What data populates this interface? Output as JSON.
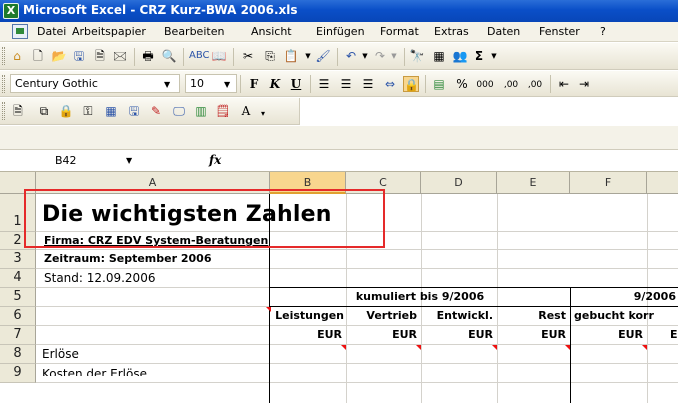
{
  "window": {
    "title": "Microsoft Excel - CRZ Kurz-BWA 2006.xls"
  },
  "menu": [
    "Datei",
    "Arbeitspapier",
    "Bearbeiten",
    "Ansicht",
    "Einfügen",
    "Format",
    "Extras",
    "Daten",
    "Fenster",
    "?"
  ],
  "format_toolbar": {
    "font": "Century Gothic",
    "size": "10",
    "bold": "F",
    "italic": "K",
    "underline": "U",
    "percent": "%",
    "thousands": "000",
    "inc_dec": ",00",
    "dec_dec": ",00"
  },
  "formula_bar": {
    "cell_ref": "B42",
    "fx": "fx",
    "content": ""
  },
  "sheet": {
    "columns": [
      "A",
      "B",
      "C",
      "D",
      "E",
      "F"
    ],
    "rows": [
      "1",
      "2",
      "3",
      "4",
      "5",
      "6",
      "7",
      "8",
      "9"
    ],
    "a1": "Die wichtigsten Zahlen",
    "a2": "Firma: CRZ EDV System-Beratungen",
    "a3": "Zeitraum: September 2006",
    "a4": "Stand: 12.09.2006",
    "kumuliert": "kumuliert bis 9/2006",
    "period": "9/2006",
    "h_leistungen": "Leistungen",
    "h_vertrieb": "Vertrieb",
    "h_entwickl": "Entwickl.",
    "h_rest": "Rest",
    "h_gebucht": "gebucht korr",
    "eur": "EUR",
    "a8": "Erlöse",
    "a9": "Kosten der Erlöse"
  }
}
